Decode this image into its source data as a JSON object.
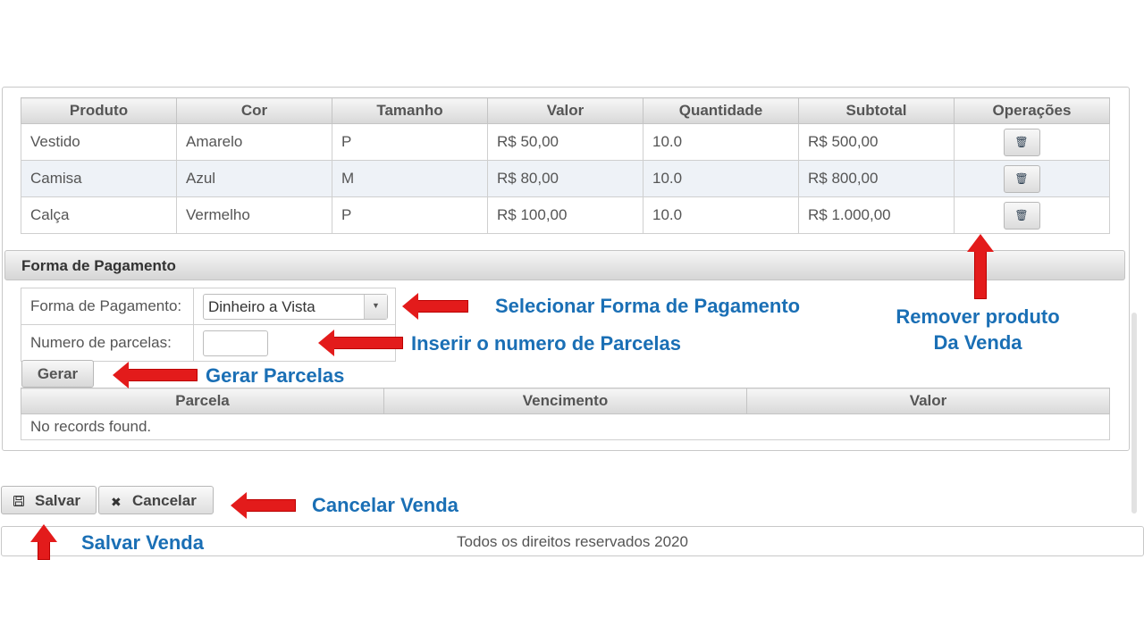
{
  "products": {
    "headers": [
      "Produto",
      "Cor",
      "Tamanho",
      "Valor",
      "Quantidade",
      "Subtotal",
      "Operações"
    ],
    "rows": [
      {
        "produto": "Vestido",
        "cor": "Amarelo",
        "tamanho": "P",
        "valor": "R$ 50,00",
        "quantidade": "10.0",
        "subtotal": "R$ 500,00"
      },
      {
        "produto": "Camisa",
        "cor": "Azul",
        "tamanho": "M",
        "valor": "R$ 80,00",
        "quantidade": "10.0",
        "subtotal": "R$ 800,00"
      },
      {
        "produto": "Calça",
        "cor": "Vermelho",
        "tamanho": "P",
        "valor": "R$ 100,00",
        "quantidade": "10.0",
        "subtotal": "R$ 1.000,00"
      }
    ],
    "delete_icon": "trash-icon"
  },
  "payment": {
    "section_title": "Forma de Pagamento",
    "method_label": "Forma de Pagamento:",
    "method_value": "Dinheiro a Vista",
    "installments_label": "Numero de parcelas:",
    "installments_value": "",
    "generate_label": "Gerar",
    "table_headers": [
      "Parcela",
      "Vencimento",
      "Valor"
    ],
    "empty_message": "No records found."
  },
  "actions": {
    "save_label": "Salvar",
    "cancel_label": "Cancelar",
    "save_icon": "floppy-disk-icon",
    "cancel_icon": "close-icon"
  },
  "footer": {
    "text": "Todos os direitos reservados 2020"
  },
  "annotations": {
    "select_payment": "Selecionar Forma de Pagamento",
    "insert_installments": "Inserir o numero de Parcelas",
    "generate_installments": "Gerar Parcelas",
    "remove_product_line1": "Remover produto",
    "remove_product_line2": "Da Venda",
    "cancel_sale": "Cancelar Venda",
    "save_sale": "Salvar Venda"
  },
  "colors": {
    "annotation_text": "#1a6fb5",
    "arrow": "#e31b1b"
  }
}
